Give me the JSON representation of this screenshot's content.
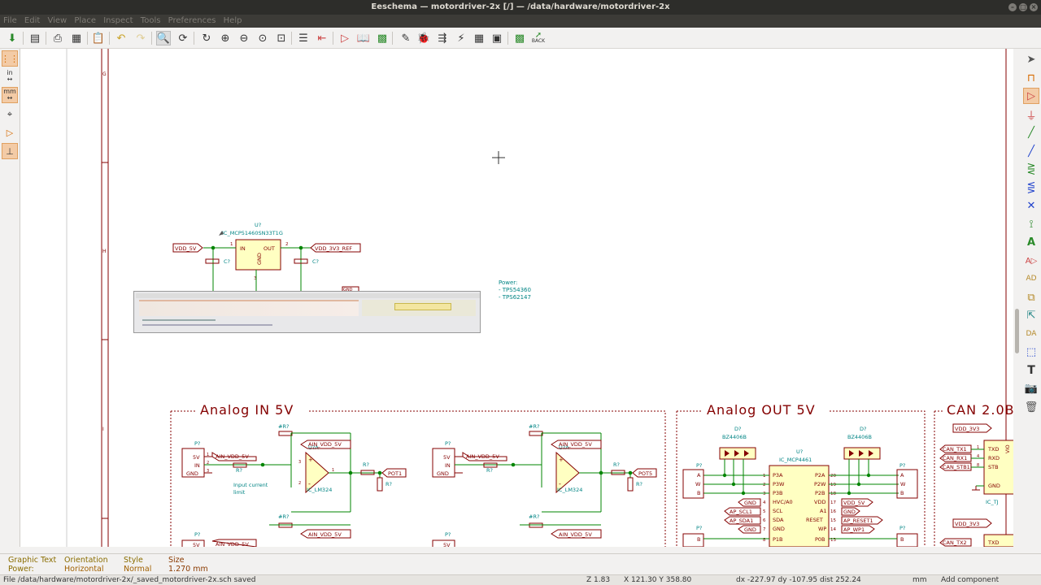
{
  "window": {
    "title": "Eeschema — motordriver-2x [/] — /data/hardware/motordriver-2x"
  },
  "menu": [
    "File",
    "Edit",
    "View",
    "Place",
    "Inspect",
    "Tools",
    "Preferences",
    "Help"
  ],
  "toolbar": {
    "back_label": "BACK"
  },
  "left_toolbar": {
    "units_in": "in",
    "units_mm": "mm"
  },
  "schematic": {
    "border_ticks": [
      "G",
      "H",
      "I"
    ],
    "regulator": {
      "ref": "U?",
      "value": "IC_MCP51460SN33T1G",
      "pin_in": "IN",
      "pin_out": "OUT",
      "pin_gnd": "GND",
      "pin1": "1",
      "pin2": "2",
      "pin3": "3",
      "in_label": "VDD_5V",
      "out_label": "VDD_3V3_REF",
      "cap_left": "C?",
      "cap_right": "C?",
      "gnd_label": "GND"
    },
    "power_note": {
      "line1": "Power:",
      "line2": "- TPS54360",
      "line3": "- TPS62147"
    },
    "sections": {
      "analog_in": "Analog IN 5V",
      "analog_out": "Analog OUT 5V",
      "can": "CAN 2.0B"
    },
    "analog_in": {
      "conn_ref": "P?",
      "conn_pins": [
        "5V",
        "IN",
        "GND"
      ],
      "conn_pin_nums": [
        "1",
        "2",
        "3"
      ],
      "supply_label": "AIN_VDD_5V",
      "res_ref": "R?",
      "feedback_ref": "#R?",
      "opamp_ref": "U?A",
      "opamp_value": "IC_LM324",
      "opamp_plus": "+",
      "opamp_minus": "-",
      "pin3": "3",
      "pin2": "2",
      "pin1": "1",
      "note_line1": "Input current",
      "note_line2": "limit",
      "out_res_ref": "R?",
      "pot_ref": "R?",
      "out_label_1": "POT1",
      "out_label_2": "POT5"
    },
    "analog_out": {
      "diode_ref": "D?",
      "diode_value": "BZ4406B",
      "ic_ref": "U?",
      "ic_value": "IC_MCP4461",
      "left_pins": [
        "P3A",
        "P3W",
        "P3B",
        "HVC/A0",
        "SCL",
        "SDA",
        "GND",
        "P1B"
      ],
      "left_pin_nums": [
        "1",
        "2",
        "3",
        "4",
        "5",
        "6",
        "7",
        "8"
      ],
      "right_pins": [
        "P2A",
        "P2W",
        "P2B",
        "VDD",
        "A1",
        "RESET",
        "WP",
        "P0B"
      ],
      "right_pin_nums": [
        "20",
        "19",
        "18",
        "17",
        "16",
        "15",
        "14",
        "13"
      ],
      "left_labels": [
        "GND",
        "AP_SCL1",
        "AP_SDA1",
        "GND"
      ],
      "right_labels": [
        "VDD_5V",
        "GND",
        "AP_RESET1",
        "AP_WP1"
      ],
      "conn_ref": "P?",
      "conn_pins": [
        "A",
        "W",
        "B"
      ]
    },
    "can": {
      "supply_label": "VDD_3V3",
      "labels": [
        "CAN_TX1",
        "CAN_RX1",
        "CAN_STB1",
        "CAN_TX2"
      ],
      "ic_pins": [
        "TXD",
        "RXD",
        "STB",
        "GND"
      ],
      "ic_ref": "IC_TJ",
      "ic_side": "VIO",
      "pin_nums": [
        "1",
        "4",
        "8"
      ]
    }
  },
  "message_panel": {
    "col1_header": "Graphic Text",
    "col1_value": "Power:",
    "col2_header": "Orientation",
    "col2_value": "Horizontal",
    "col3_header": "Style",
    "col3_value": "Normal",
    "col4_header": "Size",
    "col4_value": "1.270 mm"
  },
  "status": {
    "file": "File /data/hardware/motordriver-2x/_saved_motordriver-2x.sch saved",
    "zoom": "Z 1.83",
    "coords": "X 121.30  Y 358.80",
    "delta": "dx -227.97  dy -107.95  dist 252.24",
    "units": "mm",
    "mode": "Add component"
  },
  "colors": {
    "wire": "#008400",
    "component": "#840000",
    "label": "#840000",
    "fill": "#ffffc2",
    "junction": "#008400",
    "text": "#008484",
    "border": "#840000",
    "active_tool": "#f3cba6"
  }
}
